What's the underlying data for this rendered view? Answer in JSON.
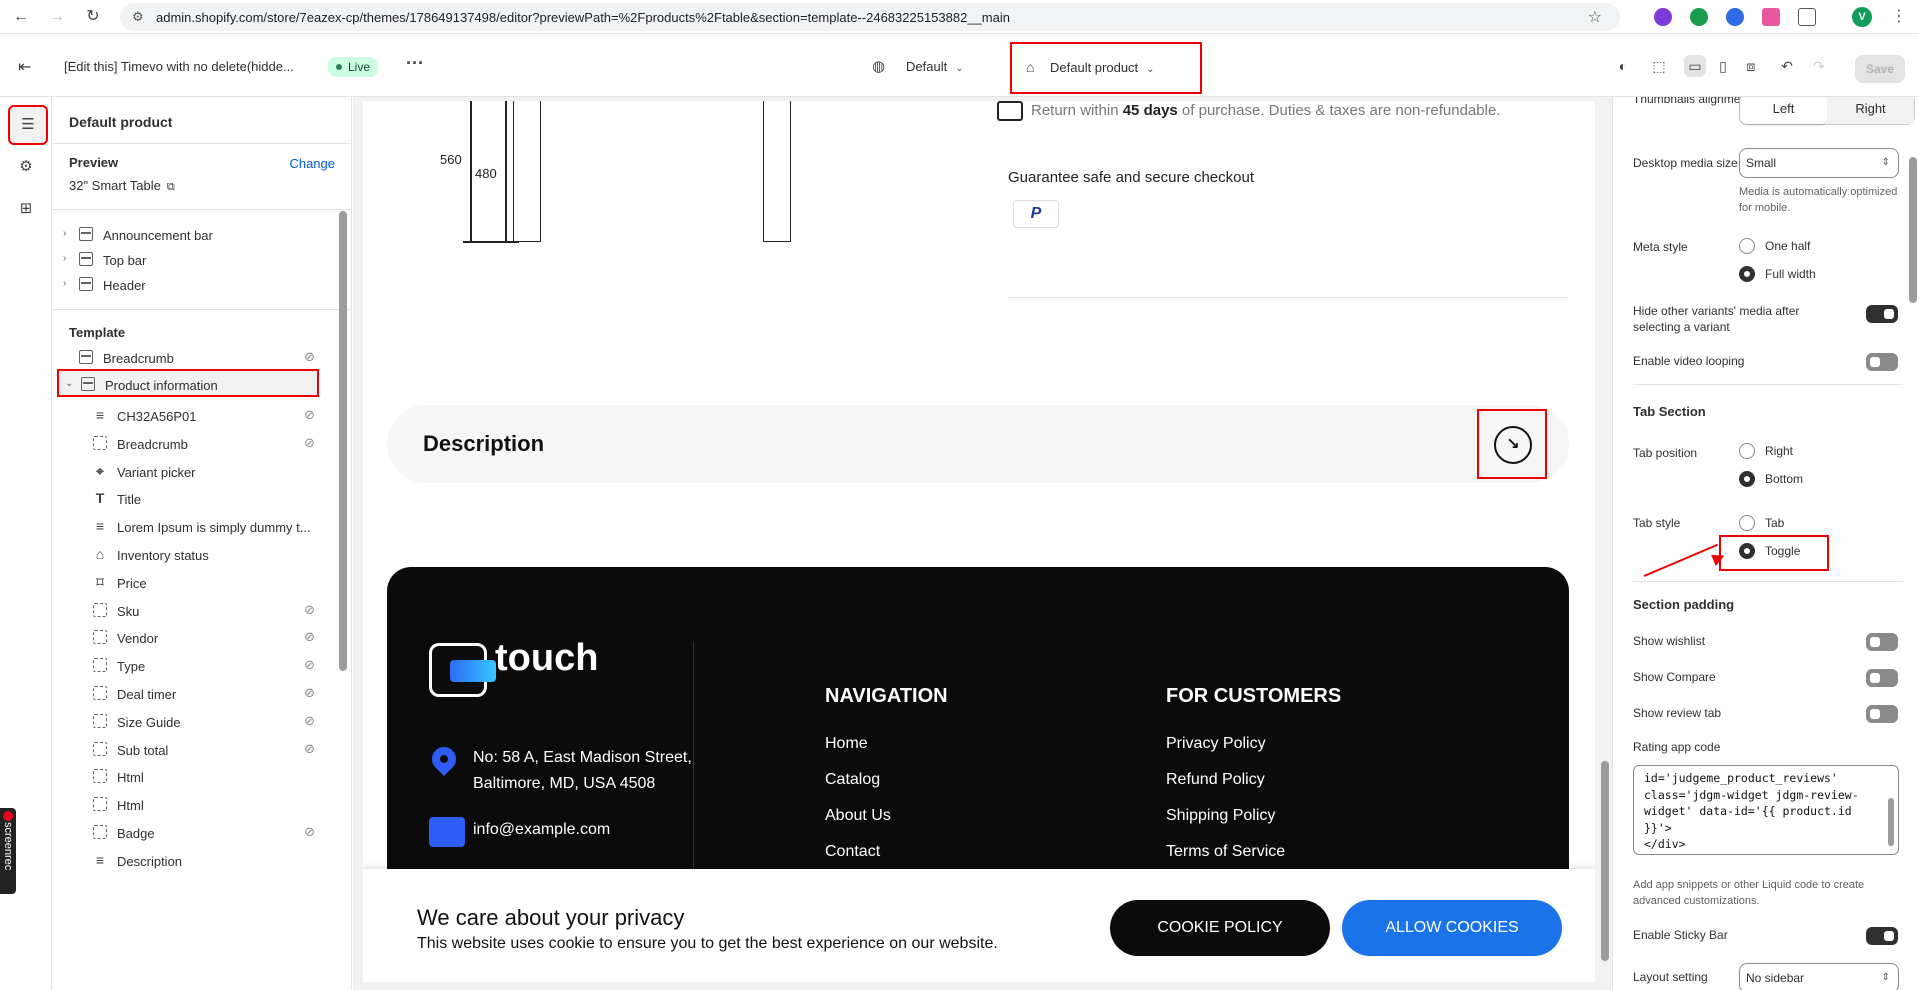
{
  "browser": {
    "url": "admin.shopify.com/store/7eazex-cp/themes/178649137498/editor?previewPath=%2Fproducts%2Ftable&section=template--24683225153882__main",
    "profile_initial": "V"
  },
  "topbar": {
    "theme_name": "[Edit this] Timevo with no delete(hidde...",
    "status_badge": "Live",
    "market": "Default",
    "template": "Default product",
    "save_label": "Save"
  },
  "panel": {
    "title": "Default product",
    "preview_label": "Preview",
    "change_label": "Change",
    "preview_value": "32\" Smart Table",
    "header_items": [
      {
        "label": "Announcement bar"
      },
      {
        "label": "Top bar"
      },
      {
        "label": "Header"
      }
    ],
    "template_heading": "Template",
    "template_items": [
      {
        "label": "Breadcrumb",
        "hidden": true
      },
      {
        "label": "Product information",
        "hidden": false
      }
    ],
    "blocks": [
      {
        "label": "CH32A56P01",
        "hidden": true,
        "icon": "text-icon"
      },
      {
        "label": "Breadcrumb",
        "hidden": true,
        "icon": "block-icon"
      },
      {
        "label": "Variant picker",
        "hidden": false,
        "icon": "variant-icon"
      },
      {
        "label": "Title",
        "hidden": false,
        "icon": "title-icon"
      },
      {
        "label": "Lorem Ipsum is simply dummy t...",
        "hidden": false,
        "icon": "text-icon"
      },
      {
        "label": "Inventory status",
        "hidden": false,
        "icon": "inventory-icon"
      },
      {
        "label": "Price",
        "hidden": false,
        "icon": "price-icon"
      },
      {
        "label": "Sku",
        "hidden": true,
        "icon": "block-icon"
      },
      {
        "label": "Vendor",
        "hidden": true,
        "icon": "block-icon"
      },
      {
        "label": "Type",
        "hidden": true,
        "icon": "block-icon"
      },
      {
        "label": "Deal timer",
        "hidden": true,
        "icon": "block-icon"
      },
      {
        "label": "Size Guide",
        "hidden": true,
        "icon": "block-icon"
      },
      {
        "label": "Sub total",
        "hidden": true,
        "icon": "block-icon"
      },
      {
        "label": "Html",
        "hidden": false,
        "icon": "block-icon"
      },
      {
        "label": "Html",
        "hidden": false,
        "icon": "block-icon"
      },
      {
        "label": "Badge",
        "hidden": true,
        "icon": "block-icon"
      },
      {
        "label": "Description",
        "hidden": false,
        "icon": "text-icon"
      }
    ]
  },
  "preview": {
    "dimension_a": "560",
    "dimension_b": "480",
    "return_text_pre": "Return within ",
    "return_bold": "45 days",
    "return_text_post": " of purchase. Duties & taxes are non-refundable.",
    "guarantee": "Guarantee safe and secure checkout",
    "paypal": "P",
    "description_title": "Description",
    "logo_text": "touch",
    "address_line1": "No: 58 A, East Madison Street,",
    "address_line2": "Baltimore, MD, USA 4508",
    "email": "info@example.com",
    "nav_heading": "NAVIGATION",
    "nav_links": [
      "Home",
      "Catalog",
      "About Us",
      "Contact"
    ],
    "customers_heading": "FOR CUSTOMERS",
    "customer_links": [
      "Privacy Policy",
      "Refund Policy",
      "Shipping Policy",
      "Terms of Service"
    ],
    "cookie_title": "We care about your privacy",
    "cookie_text": "This website uses cookie to ensure you to get the best experience on our website.",
    "cookie_policy_btn": "COOKIE POLICY",
    "allow_cookies_btn": "ALLOW COOKIES"
  },
  "settings": {
    "thumbnails_alignment_label": "Thumbnails alignment",
    "thumbnails_options": [
      "Left",
      "Right"
    ],
    "thumbnails_selected": "Left",
    "desktop_media_size_label": "Desktop media size",
    "desktop_media_size_value": "Small",
    "desktop_media_help": "Media is automatically optimized for mobile.",
    "meta_style_label": "Meta style",
    "meta_style_options": [
      "One half",
      "Full width"
    ],
    "meta_style_selected": "Full width",
    "hide_variants_label": "Hide other variants' media after selecting a variant",
    "hide_variants_on": true,
    "video_looping_label": "Enable video looping",
    "video_looping_on": false,
    "tab_section_heading": "Tab Section",
    "tab_position_label": "Tab position",
    "tab_position_options": [
      "Right",
      "Bottom"
    ],
    "tab_position_selected": "Bottom",
    "tab_style_label": "Tab style",
    "tab_style_options": [
      "Tab",
      "Toggle"
    ],
    "tab_style_selected": "Toggle",
    "section_padding_heading": "Section padding",
    "show_wishlist_label": "Show wishlist",
    "show_compare_label": "Show Compare",
    "show_review_tab_label": "Show review tab",
    "rating_app_code_label": "Rating app code",
    "rating_app_code": "id='judgeme_product_reviews'\nclass='jdgm-widget jdgm-review-\nwidget' data-id='{{ product.id\n}}'>\n</div>",
    "rating_help": "Add app snippets or other Liquid code to create advanced customizations.",
    "sticky_bar_label": "Enable Sticky Bar",
    "sticky_bar_on": true,
    "layout_setting_label": "Layout setting",
    "layout_setting_value": "No sidebar"
  },
  "screenrec_label": "screenrec"
}
